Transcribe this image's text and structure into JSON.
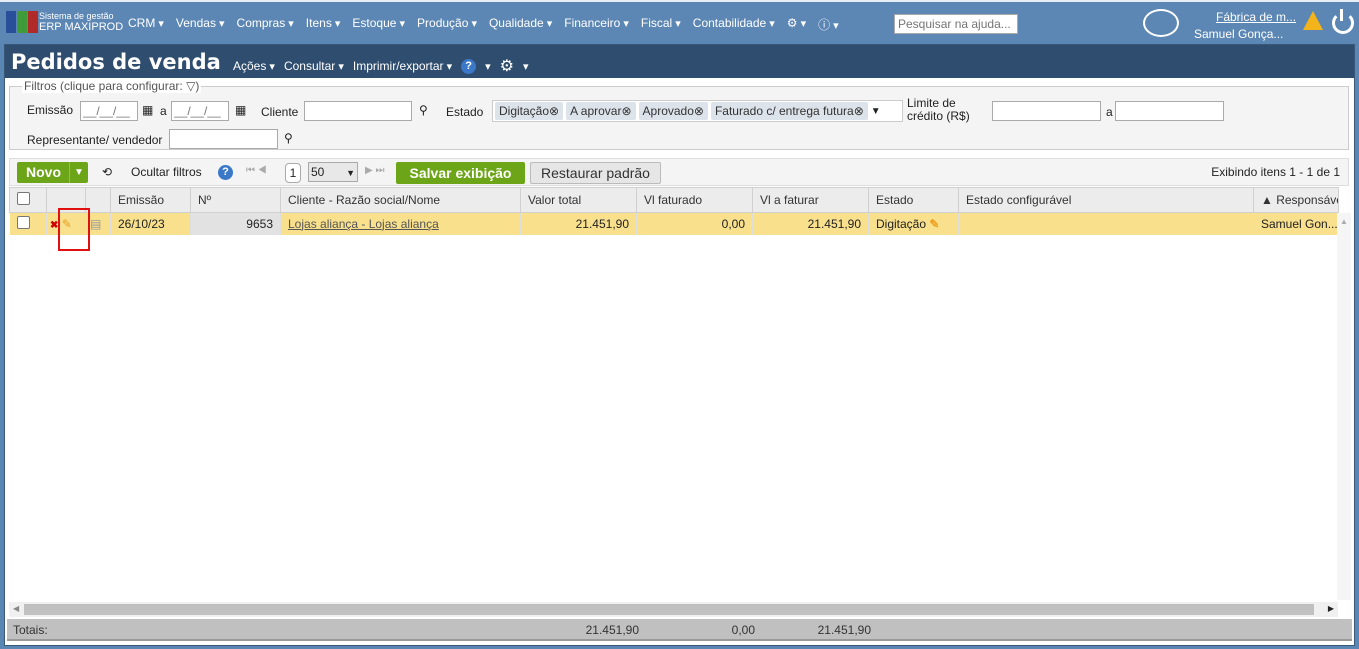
{
  "app": {
    "brand_line1": "Sistema de gestão",
    "brand_line2": "ERP MAXIPROD"
  },
  "top_menu": [
    "CRM",
    "Vendas",
    "Compras",
    "Itens",
    "Estoque",
    "Produção",
    "Qualidade",
    "Financeiro",
    "Fiscal",
    "Contabilidade"
  ],
  "help_search": {
    "placeholder": "Pesquisar na ajuda..."
  },
  "company": "Fábrica de m...",
  "user": "Samuel Gonça...",
  "page": {
    "title": "Pedidos de venda",
    "menu": [
      "Ações",
      "Consultar",
      "Imprimir/exportar"
    ]
  },
  "filters": {
    "legend": "Filtros (clique para configurar:",
    "legend_end": ")",
    "emissao": "Emissão",
    "date_placeholder": "__/__/__",
    "a": "a",
    "cliente": "Cliente",
    "estado": "Estado",
    "estado_chips": [
      "Digitação",
      "A aprovar",
      "Aprovado",
      "Faturado c/ entrega futura"
    ],
    "limite": "Limite de crédito (R$)",
    "representante": "Representante/ vendedor"
  },
  "toolbar": {
    "novo": "Novo",
    "ocultar": "Ocultar filtros",
    "page": "1",
    "page_size": "50",
    "salvar": "Salvar exibição",
    "restaurar": "Restaurar padrão",
    "status": "Exibindo itens 1 - 1 de 1"
  },
  "columns": [
    "Emissão",
    "Nº",
    "Cliente - Razão social/Nome",
    "Valor total",
    "Vl faturado",
    "Vl a faturar",
    "Estado",
    "Estado configurável",
    "▲ Responsáve"
  ],
  "rows": [
    {
      "emissao": "26/10/23",
      "numero": "9653",
      "cliente": "Lojas aliança - Lojas aliança",
      "valor_total": "21.451,90",
      "vl_faturado": "0,00",
      "vl_a_faturar": "21.451,90",
      "estado": "Digitação",
      "estado_config": "",
      "responsavel": "Samuel Gon..."
    }
  ],
  "totals": {
    "label": "Totais:",
    "valor_total": "21.451,90",
    "vl_faturado": "0,00",
    "vl_a_faturar": "21.451,90"
  }
}
